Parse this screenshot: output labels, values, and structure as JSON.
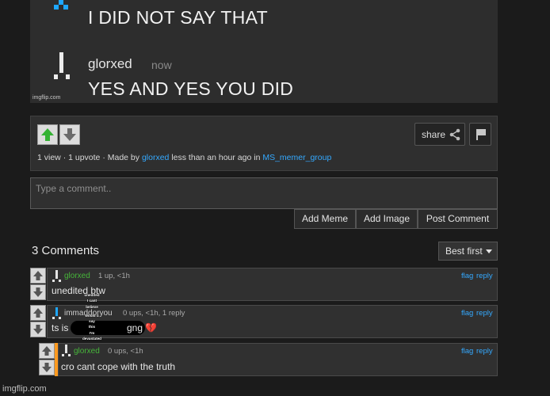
{
  "meme": {
    "message_1": "I DID NOT SAY THAT",
    "username": "glorxed",
    "time": "now",
    "message_2": "YES AND YES YOU DID",
    "watermark": "imgflip.com"
  },
  "post_info": {
    "views": "1 view",
    "upvotes": "1 upvote",
    "made_by_label": "Made by",
    "author": "glorxed",
    "time_label": "less than an hour ago in",
    "stream": "MS_memer_group",
    "separator": "·",
    "share_label": "share"
  },
  "comment_input": {
    "placeholder": "Type a comment.."
  },
  "actions": {
    "add_meme": "Add Meme",
    "add_image": "Add Image",
    "post_comment": "Post Comment"
  },
  "comments_header": {
    "title": "3 Comments",
    "sort_label": "Best first"
  },
  "comments": [
    {
      "user": "glorxed",
      "meta": "1 up, <1h",
      "text": "unedited btw",
      "flag": "flag",
      "reply": "reply"
    },
    {
      "user": "immaddoryou",
      "meta": "0 ups, <1h, 1 reply",
      "text_start": "ts is",
      "text_end": "gng 💔",
      "overlay_lines": [
        "unedited",
        "I cant",
        "believe",
        "would u",
        "say",
        "this",
        "I'm",
        "devastated"
      ],
      "flag": "flag",
      "reply": "reply"
    },
    {
      "user": "glorxed",
      "meta": "0 ups, <1h",
      "text": "cro cant cope with the truth",
      "flag": "flag",
      "reply": "reply"
    }
  ],
  "footer": {
    "watermark": "imgflip.com"
  },
  "colors": {
    "link": "#34a9ff",
    "username_green": "#46b53a",
    "upvote_green": "#34b233",
    "reply_indent_bar": "#ff9a1f"
  }
}
